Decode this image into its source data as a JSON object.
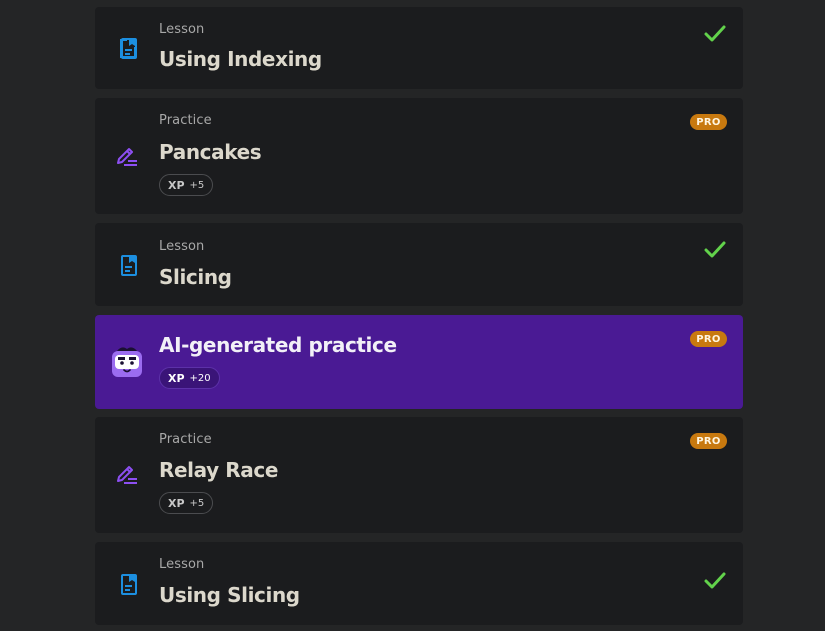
{
  "colors": {
    "background": "#242526",
    "card": "#1b1c1e",
    "ai_card": "#4a1a94",
    "lesson_icon": "#1c8fe0",
    "practice_icon": "#8d4ff2",
    "check": "#62d24b",
    "pro_badge": "#c8790f"
  },
  "items": [
    {
      "kind": "Lesson",
      "title": "Using Indexing",
      "icon": "lesson-document-icon",
      "status": "completed-check-icon"
    },
    {
      "kind": "Practice",
      "title": "Pancakes",
      "icon": "practice-pencil-icon",
      "badge": "PRO",
      "xp_label": "XP",
      "xp_value": "+5"
    },
    {
      "kind": "Lesson",
      "title": "Slicing",
      "icon": "lesson-document-icon",
      "status": "completed-check-icon"
    },
    {
      "title": "AI-generated practice",
      "icon": "ai-robot-mascot-icon",
      "badge": "PRO",
      "xp_label": "XP",
      "xp_value": "+20"
    },
    {
      "kind": "Practice",
      "title": "Relay Race",
      "icon": "practice-pencil-icon",
      "badge": "PRO",
      "xp_label": "XP",
      "xp_value": "+5"
    },
    {
      "kind": "Lesson",
      "title": "Using Slicing",
      "icon": "lesson-document-icon",
      "status": "completed-check-icon"
    }
  ]
}
